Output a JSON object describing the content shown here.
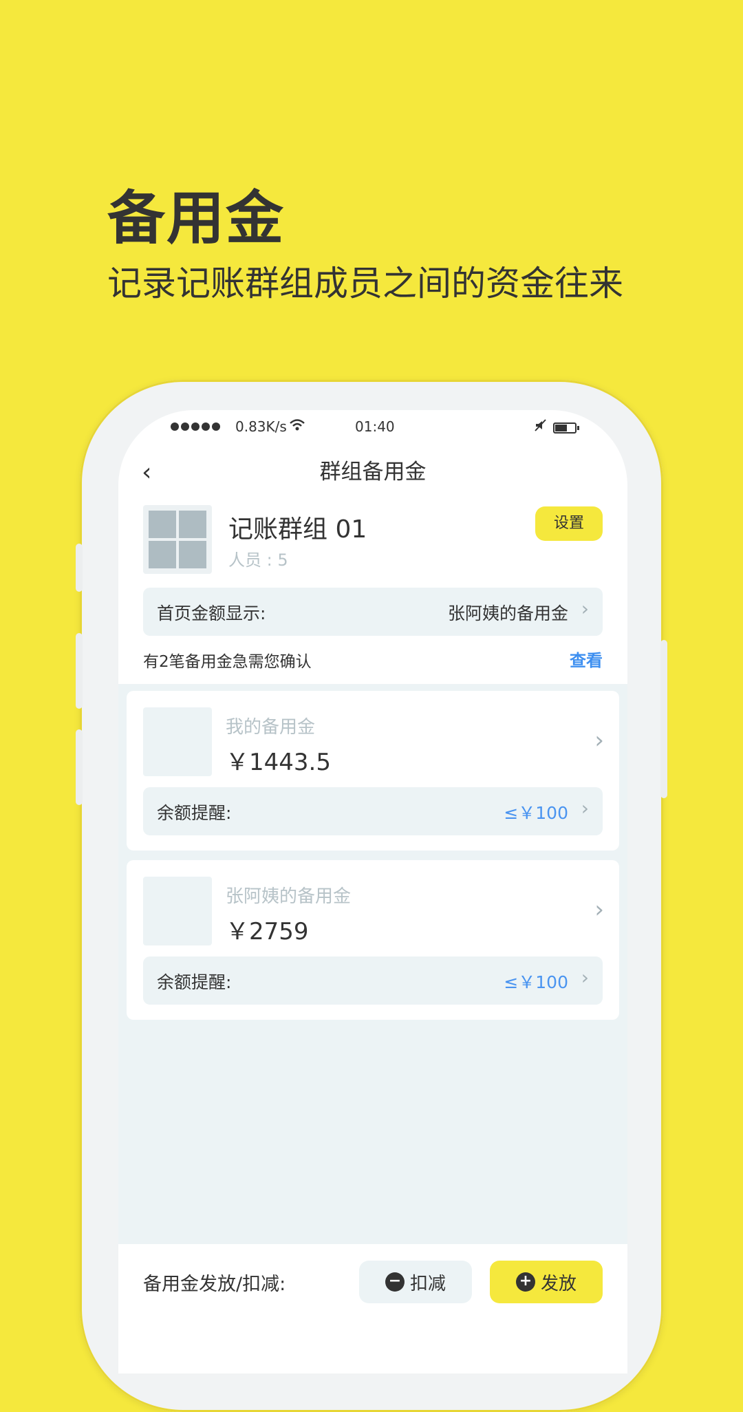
{
  "hero": {
    "title": "备用金",
    "subtitle": "记录记账群组成员之间的资金往来"
  },
  "status_bar": {
    "network_speed": "0.83K/s",
    "time": "01:40",
    "battery_level": 0.6
  },
  "nav": {
    "back_icon": "‹",
    "title": "群组备用金"
  },
  "group": {
    "name": "记账群组 01",
    "members": "人员 : 5",
    "settings_label": "设置"
  },
  "home_amount": {
    "label": "首页金额显示:",
    "value": "张阿姨的备用金"
  },
  "notice": {
    "text": "有2笔备用金急需您确认",
    "link": "查看"
  },
  "cards": [
    {
      "name": "我的备用金",
      "amount": "￥1443.5",
      "reminder_label": "余额提醒:",
      "reminder_value": "≤￥100"
    },
    {
      "name": "张阿姨的备用金",
      "amount": "￥2759",
      "reminder_label": "余额提醒:",
      "reminder_value": "≤￥100"
    }
  ],
  "bottom": {
    "label": "备用金发放/扣减:",
    "deduct_label": "扣减",
    "issue_label": "发放"
  },
  "colors": {
    "brand_yellow": "#f5e83d",
    "link_blue": "#3d8ff0",
    "panel_gray": "#ecf3f5"
  },
  "icons": {
    "chevron": "›",
    "minus": "−",
    "plus": "+"
  }
}
